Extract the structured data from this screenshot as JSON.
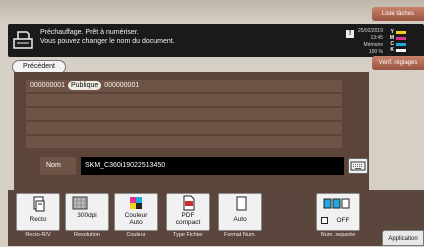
{
  "status": {
    "line1": "Préchauffage. Prêt à numériser.",
    "line2": "Vous pouvez changer le nom du document.",
    "date": "25/02/2019",
    "time": "13:45",
    "memory_label": "Mémoire",
    "memory_value": "100 %",
    "toner": [
      "Y",
      "M",
      "C",
      "K"
    ],
    "toner_colors": [
      "#f2d21a",
      "#e0338f",
      "#21a8e0",
      "#222222"
    ]
  },
  "side": {
    "job_list": "Liste tâches",
    "check_settings": "Vérif. réglages"
  },
  "nav": {
    "previous": "Précédent"
  },
  "doc_list": {
    "row1_before": "000000001",
    "row1_pill": "Publique",
    "row1_after": "000000001"
  },
  "name_field": {
    "label": "Nom",
    "value": "SKM_C360i19022513450"
  },
  "functions": [
    {
      "button": "Recto",
      "label": "Recto-R/V"
    },
    {
      "button": "300dpi",
      "label": "Resolution"
    },
    {
      "button": "Couleur\nAuto",
      "label": "Couleur"
    },
    {
      "button": "PDF\ncompact",
      "label": "Type Fichier"
    },
    {
      "button": "Auto",
      "label": "Format Num."
    },
    {
      "button": "OFF",
      "label": "Num. separée"
    }
  ],
  "application": "Application"
}
